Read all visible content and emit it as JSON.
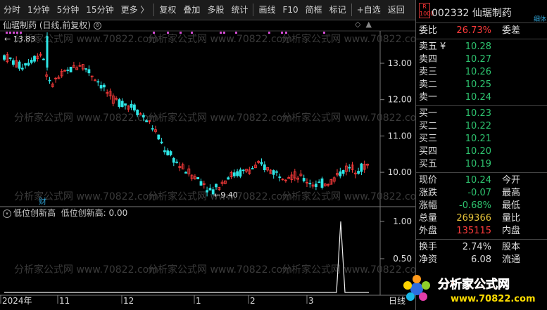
{
  "toolbar": {
    "items": [
      "分时",
      "1分钟",
      "5分钟",
      "15分钟",
      "更多 〉",
      "复权",
      "叠加",
      "多股",
      "统计",
      "画线",
      "F10",
      "简框",
      "标记",
      "+自选",
      "返回"
    ]
  },
  "chart": {
    "title": "仙琚制药 (日线,前复权)",
    "high_label": "13.83",
    "low_label": "9.40",
    "cai_label": "财",
    "y_ticks": [
      "13.00",
      "12.00",
      "11.00",
      "10.00"
    ],
    "x_ticks": [
      "2024年",
      "11",
      "12",
      "1",
      "2",
      "3"
    ],
    "x_end": "日线",
    "watermark": "分析家公式网 www.70822.com"
  },
  "indicator": {
    "title": "低位创新高",
    "value_text": "低位创新高: 0.00",
    "y_ticks": [
      "1.00",
      "0.50"
    ]
  },
  "quote": {
    "badge": "R 1000",
    "code_name": "002332 仙琚制药",
    "corner": "细体",
    "weibi_label": "委比",
    "weibi_value": "26.73%",
    "weicha_label": "委差",
    "asks": [
      {
        "label": "卖五",
        "mark": "¥",
        "price": "10.28"
      },
      {
        "label": "卖四",
        "mark": "",
        "price": "10.27"
      },
      {
        "label": "卖三",
        "mark": "",
        "price": "10.26"
      },
      {
        "label": "卖二",
        "mark": "",
        "price": "10.25"
      },
      {
        "label": "卖一",
        "mark": "",
        "price": "10.24"
      }
    ],
    "bids": [
      {
        "label": "买一",
        "price": "10.23"
      },
      {
        "label": "买二",
        "price": "10.22"
      },
      {
        "label": "买三",
        "price": "10.21"
      },
      {
        "label": "买四",
        "price": "10.20"
      },
      {
        "label": "买五",
        "price": "10.19"
      }
    ],
    "stats": [
      {
        "l": "现价",
        "v": "10.24",
        "c": "green",
        "r": "今开"
      },
      {
        "l": "涨跌",
        "v": "-0.07",
        "c": "green",
        "r": "最高"
      },
      {
        "l": "涨幅",
        "v": "-0.68%",
        "c": "green",
        "r": "最低"
      },
      {
        "l": "总量",
        "v": "269366",
        "c": "yellow",
        "r": "量比"
      },
      {
        "l": "外盘",
        "v": "135115",
        "c": "red",
        "r": "内盘"
      }
    ],
    "stats2": [
      {
        "l": "换手",
        "v": "2.74%",
        "c": "white",
        "r": "股本"
      },
      {
        "l": "净资",
        "v": "6.08",
        "c": "white",
        "r": "流通"
      }
    ]
  },
  "logo": {
    "line1": "分析家公式网",
    "line2": "www.70822.com"
  },
  "colors": {
    "up": "#ff3b3b",
    "down": "#2ee6e6",
    "purple": "#d24bd2",
    "bg": "#000000"
  }
}
